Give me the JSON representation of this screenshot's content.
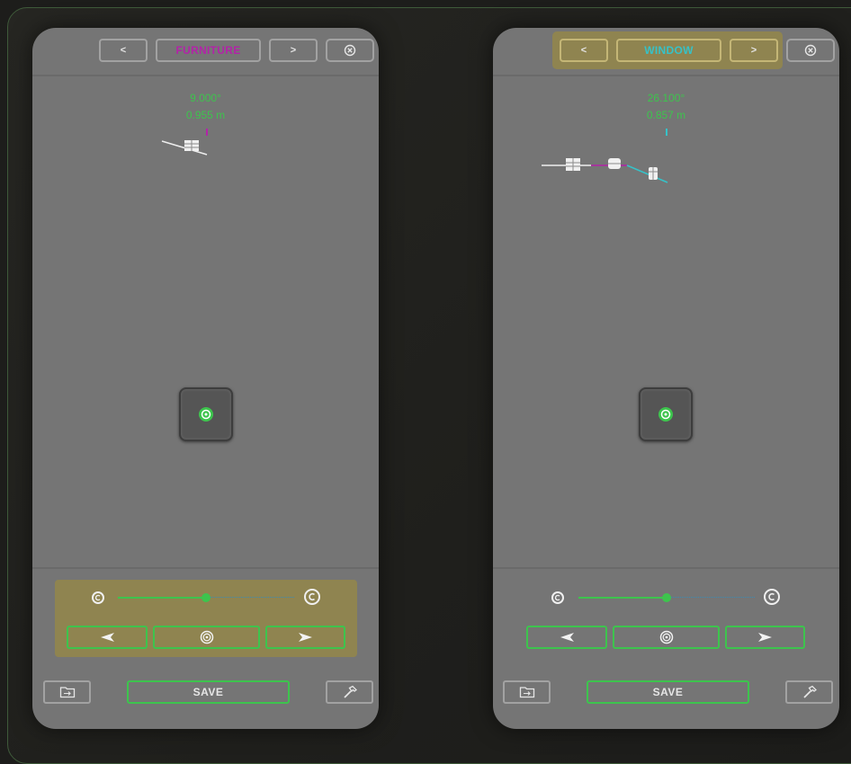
{
  "colors": {
    "accent_green": "#3dc44d",
    "highlight_gold": "#8f8450",
    "furniture_magenta": "#b323a8",
    "window_teal": "#36c2c8",
    "panel_gray": "#757575"
  },
  "panels": [
    {
      "id": "furniture",
      "nav": {
        "prev_label": "<",
        "title": "FURNITURE",
        "next_label": ">",
        "close_icon": "close-circle-icon",
        "highlighted": false
      },
      "readout": {
        "angle": "9.000°",
        "distance": "0.955 m"
      },
      "preview_objects": [
        "desk-icon"
      ],
      "center_button_icon": "target-icon",
      "rotation": {
        "left_icon": "rotate-ccw-icon",
        "right_icon": "rotate-cw-icon",
        "value": 0.5
      },
      "move": {
        "left_icon": "arrow-left-icon",
        "center_icon": "concentric-circle-icon",
        "right_icon": "arrow-right-icon"
      },
      "controls_highlighted": true,
      "footer": {
        "folder_icon": "folder-icon",
        "save_label": "SAVE",
        "tool_icon": "hammer-icon"
      }
    },
    {
      "id": "window",
      "nav": {
        "prev_label": "<",
        "title": "WINDOW",
        "next_label": ">",
        "close_icon": "close-circle-icon",
        "highlighted": true
      },
      "readout": {
        "angle": "26.100°",
        "distance": "0.857 m"
      },
      "preview_objects": [
        "desk-icon",
        "sofa-icon",
        "window-icon"
      ],
      "center_button_icon": "target-icon",
      "rotation": {
        "left_icon": "rotate-ccw-icon",
        "right_icon": "rotate-cw-icon",
        "value": 0.5
      },
      "move": {
        "left_icon": "arrow-left-icon",
        "center_icon": "concentric-circle-icon",
        "right_icon": "arrow-right-icon"
      },
      "controls_highlighted": false,
      "footer": {
        "folder_icon": "folder-icon",
        "save_label": "SAVE",
        "tool_icon": "hammer-icon"
      }
    }
  ]
}
